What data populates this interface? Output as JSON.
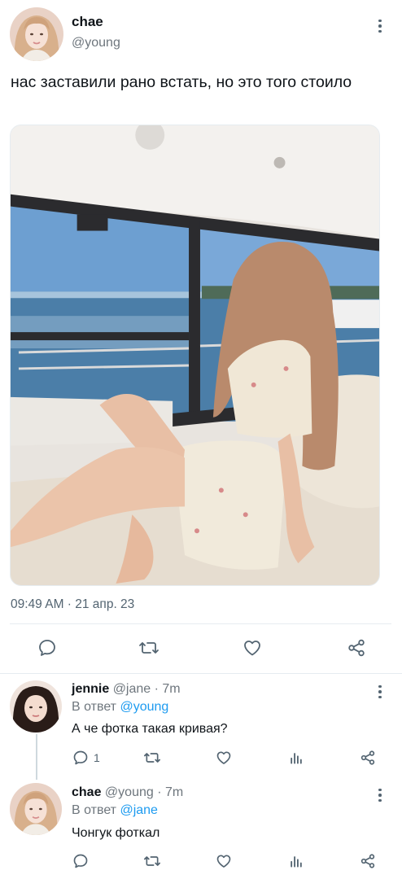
{
  "main_tweet": {
    "author_name": "chae",
    "author_handle": "@young",
    "text": "нас заставили рано встать, но это того стоило",
    "timestamp": "09:49 AM · 21 апр. 23",
    "photo_description": "girl-on-yacht",
    "actions": [
      "reply-icon",
      "retweet-icon",
      "like-icon",
      "share-icon"
    ]
  },
  "replies": [
    {
      "author_name": "jennie",
      "author_handle": "@jane",
      "time_sep": " · ",
      "time": "7m",
      "reply_to_prefix": "В ответ ",
      "reply_to_handle": "@young",
      "text": "А че фотка такая кривая?",
      "reply_count": "1"
    },
    {
      "author_name": "chae",
      "author_handle": "@young",
      "time_sep": " · ",
      "time": "7m",
      "reply_to_prefix": "В ответ ",
      "reply_to_handle": "@jane",
      "text": "Чонгук фоткал",
      "reply_count": ""
    }
  ],
  "colors": {
    "text": "#0f1419",
    "secondary": "#536471",
    "accent": "#1d9bf0",
    "divider": "#e6ecf0"
  }
}
